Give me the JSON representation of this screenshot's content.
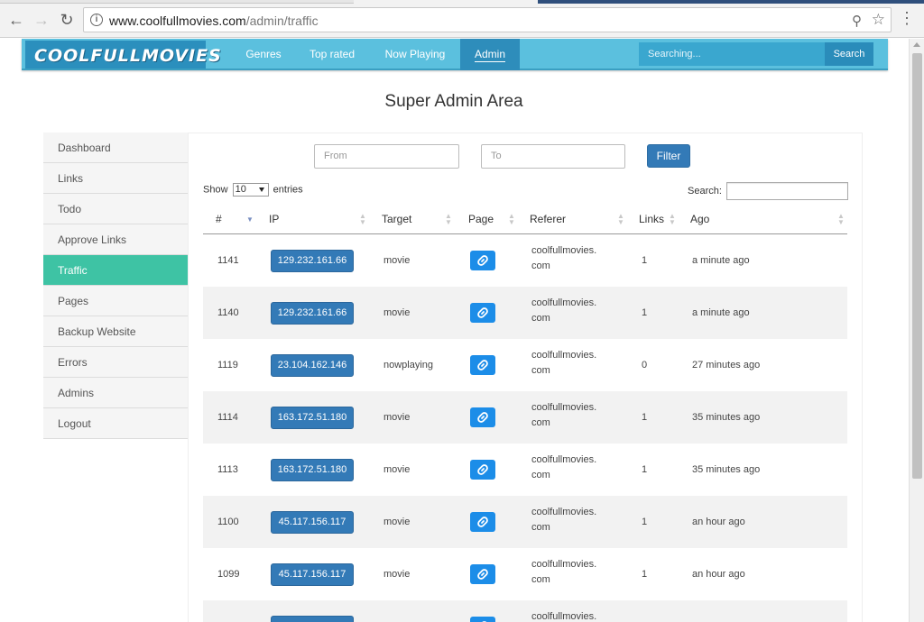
{
  "browser": {
    "url_domain": "www.coolfullmovies.com",
    "url_path": "/admin/traffic"
  },
  "site": {
    "logo": "COOLFULLMOVIES",
    "nav": [
      "Genres",
      "Top rated",
      "Now Playing",
      "Admin"
    ],
    "search_placeholder": "Searching...",
    "search_button": "Search"
  },
  "page_title": "Super Admin Area",
  "sidebar": {
    "items": [
      "Dashboard",
      "Links",
      "Todo",
      "Approve Links",
      "Traffic",
      "Pages",
      "Backup Website",
      "Errors",
      "Admins",
      "Logout"
    ],
    "active": "Traffic"
  },
  "filter": {
    "from_placeholder": "From",
    "to_placeholder": "To",
    "button": "Filter"
  },
  "table_controls": {
    "show_label": "Show",
    "entries_value": "10",
    "entries_label": "entries",
    "search_label": "Search:"
  },
  "table": {
    "columns": [
      "#",
      "IP",
      "Target",
      "Page",
      "Referer",
      "Links",
      "Ago"
    ],
    "rows": [
      {
        "num": "1141",
        "ip": "129.232.161.66",
        "target": "movie",
        "referer_1": "coolfullmovies.",
        "referer_2": "com",
        "links": "1",
        "ago": "a minute ago"
      },
      {
        "num": "1140",
        "ip": "129.232.161.66",
        "target": "movie",
        "referer_1": "coolfullmovies.",
        "referer_2": "com",
        "links": "1",
        "ago": "a minute ago"
      },
      {
        "num": "1119",
        "ip": "23.104.162.146",
        "target": "nowplaying",
        "referer_1": "coolfullmovies.",
        "referer_2": "com",
        "links": "0",
        "ago": "27 minutes ago"
      },
      {
        "num": "1114",
        "ip": "163.172.51.180",
        "target": "movie",
        "referer_1": "coolfullmovies.",
        "referer_2": "com",
        "links": "1",
        "ago": "35 minutes ago"
      },
      {
        "num": "1113",
        "ip": "163.172.51.180",
        "target": "movie",
        "referer_1": "coolfullmovies.",
        "referer_2": "com",
        "links": "1",
        "ago": "35 minutes ago"
      },
      {
        "num": "1100",
        "ip": "45.117.156.117",
        "target": "movie",
        "referer_1": "coolfullmovies.",
        "referer_2": "com",
        "links": "1",
        "ago": "an hour ago"
      },
      {
        "num": "1099",
        "ip": "45.117.156.117",
        "target": "movie",
        "referer_1": "coolfullmovies.",
        "referer_2": "com",
        "links": "1",
        "ago": "an hour ago"
      },
      {
        "num": "",
        "ip": "",
        "target": "",
        "referer_1": "coolfullmovies.",
        "referer_2": "",
        "links": "",
        "ago": ""
      }
    ]
  },
  "colors": {
    "header": "#5bc0de",
    "active_sidebar": "#3ec3a4",
    "primary_button": "#337ab7",
    "link_button": "#1c8de8"
  }
}
